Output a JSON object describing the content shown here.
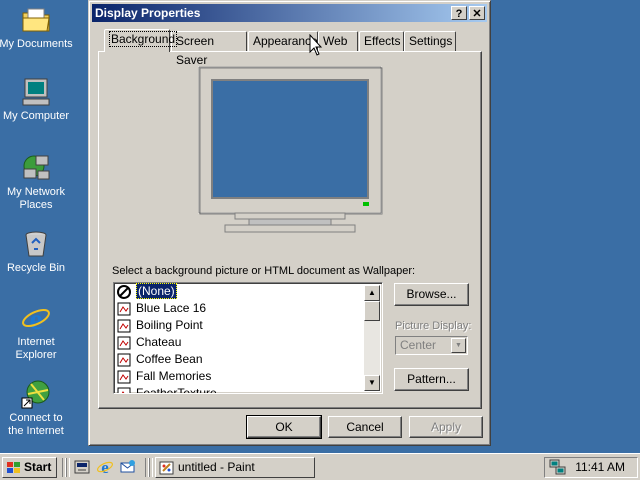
{
  "desktop": {
    "icons": [
      {
        "label": "My Documents",
        "icon": "folder-documents-icon"
      },
      {
        "label": "My Computer",
        "icon": "computer-icon"
      },
      {
        "label_line1": "My Network",
        "label_line2": "Places",
        "icon": "network-places-icon"
      },
      {
        "label": "Recycle Bin",
        "icon": "recycle-bin-icon"
      },
      {
        "label_line1": "Internet",
        "label_line2": "Explorer",
        "icon": "internet-explorer-icon"
      },
      {
        "label_line1": "Connect to",
        "label_line2": "the Internet",
        "icon": "connect-internet-icon"
      }
    ],
    "background_color": "#3a6ea5"
  },
  "window": {
    "title": "Display Properties",
    "help_glyph": "?",
    "close_glyph": "✕",
    "tabs": [
      {
        "label": "Background",
        "active": true
      },
      {
        "label": "Screen Saver",
        "active": false
      },
      {
        "label": "Appearance",
        "active": false
      },
      {
        "label": "Web",
        "active": false
      },
      {
        "label": "Effects",
        "active": false
      },
      {
        "label": "Settings",
        "active": false
      }
    ],
    "wallpaper_label": "Select a background picture or HTML document as Wallpaper:",
    "wallpaper_list": [
      {
        "label": "(None)",
        "selected": true,
        "icon": "none-icon"
      },
      {
        "label": "Blue Lace 16",
        "selected": false,
        "icon": "bitmap-icon"
      },
      {
        "label": "Boiling Point",
        "selected": false,
        "icon": "bitmap-icon"
      },
      {
        "label": "Chateau",
        "selected": false,
        "icon": "bitmap-icon"
      },
      {
        "label": "Coffee Bean",
        "selected": false,
        "icon": "bitmap-icon"
      },
      {
        "label": "Fall Memories",
        "selected": false,
        "icon": "bitmap-icon"
      },
      {
        "label": "FeatherTexture",
        "selected": false,
        "icon": "bitmap-icon"
      }
    ],
    "browse_label": "Browse...",
    "picture_display_label": "Picture Display:",
    "picture_display_value": "Center",
    "pattern_label": "Pattern...",
    "ok_label": "OK",
    "cancel_label": "Cancel",
    "apply_label": "Apply",
    "preview_screen_color": "#3a6ea5"
  },
  "taskbar": {
    "start_label": "Start",
    "quick_launch": [
      "show-desktop-icon",
      "internet-explorer-icon",
      "outlook-express-icon"
    ],
    "tasks": [
      {
        "label": "untitled - Paint",
        "icon": "paint-icon"
      }
    ],
    "clock": "11:41 AM"
  }
}
